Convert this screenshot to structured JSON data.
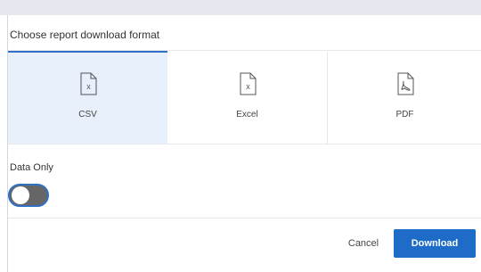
{
  "dialog": {
    "title": "Choose report download format",
    "formats": [
      {
        "label": "CSV",
        "icon": "csv-file-icon",
        "selected": true
      },
      {
        "label": "Excel",
        "icon": "excel-file-icon",
        "selected": false
      },
      {
        "label": "PDF",
        "icon": "pdf-file-icon",
        "selected": false
      }
    ],
    "data_only": {
      "label": "Data Only",
      "enabled": false
    },
    "cancel_label": "Cancel",
    "download_label": "Download"
  },
  "colors": {
    "accent": "#1e6cc8",
    "selected_bg": "#e8f0fb",
    "toggle_off": "#666666"
  }
}
